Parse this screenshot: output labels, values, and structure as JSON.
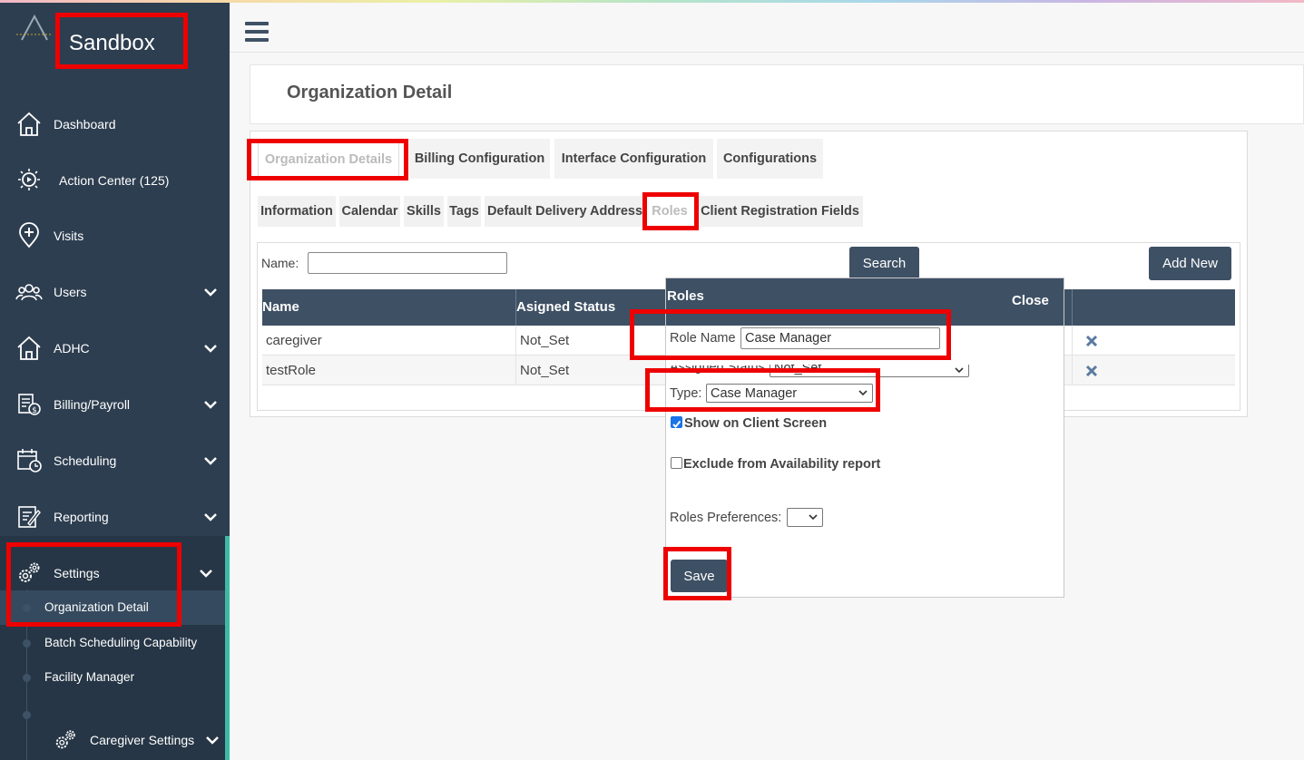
{
  "brand": {
    "name": "Sandbox"
  },
  "sidebar": {
    "items": [
      {
        "label": "Dashboard",
        "icon": "home-icon"
      },
      {
        "label": "Action Center (125)",
        "icon": "play-sparkle-icon"
      },
      {
        "label": "Visits",
        "icon": "location-plus-icon"
      },
      {
        "label": "Users",
        "icon": "users-icon"
      },
      {
        "label": "ADHC",
        "icon": "home-icon"
      },
      {
        "label": "Billing/Payroll",
        "icon": "billing-icon"
      },
      {
        "label": "Scheduling",
        "icon": "calendar-clock-icon"
      },
      {
        "label": "Reporting",
        "icon": "report-icon"
      },
      {
        "label": "Settings",
        "icon": "gears-icon"
      }
    ],
    "settings_sub": [
      {
        "label": "Organization Detail"
      },
      {
        "label": "Batch Scheduling Capability"
      },
      {
        "label": "Facility Manager"
      },
      {
        "label": "Caregiver Settings"
      }
    ]
  },
  "page": {
    "title": "Organization Detail"
  },
  "tabs": [
    "Organization Details",
    "Billing Configuration",
    "Interface Configuration",
    "Configurations"
  ],
  "subtabs": [
    "Information",
    "Calendar",
    "Skills",
    "Tags",
    "Default Delivery Address",
    "Roles",
    "Client Registration Fields"
  ],
  "filter": {
    "name_label": "Name:",
    "name_value": "",
    "search_label": "Search",
    "add_new_label": "Add New"
  },
  "grid": {
    "columns": [
      "Name",
      "Asigned Status"
    ],
    "rows": [
      {
        "name": "caregiver",
        "status": "Not_Set"
      },
      {
        "name": "testRole",
        "status": "Not_Set"
      }
    ]
  },
  "popup": {
    "title": "Roles",
    "close_label": "Close",
    "role_name_label": "Role Name",
    "role_name_value": "Case Manager",
    "assigned_status_label": "Assigned Status",
    "assigned_status_value": "Not_Set",
    "type_label": "Type:",
    "type_value": "Case Manager",
    "show_client_label": "Show on Client Screen",
    "show_client_checked": true,
    "exclude_label": "Exclude from Availability report",
    "exclude_checked": false,
    "roles_pref_label": "Roles Preferences:",
    "roles_pref_value": "",
    "save_label": "Save"
  },
  "colors": {
    "sidebar": "#2d3e50",
    "header": "#3e5064",
    "accent": "#3fb9a5",
    "highlight": "#ee0000"
  }
}
